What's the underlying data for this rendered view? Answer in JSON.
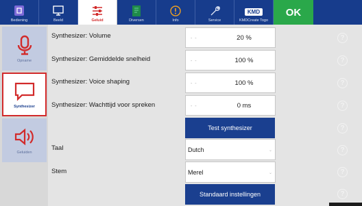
{
  "tabs": [
    {
      "label": "Bediening",
      "icon": "bediening-icon"
    },
    {
      "label": "Beeld",
      "icon": "monitor-icon"
    },
    {
      "label": "Geluid",
      "icon": "sliders-icon",
      "active": true
    },
    {
      "label": "Diversen",
      "icon": "diversen-icon"
    },
    {
      "label": "Info",
      "icon": "info-icon"
    },
    {
      "label": "Service",
      "icon": "wrench-icon"
    },
    {
      "label": "KMDCreate Togo",
      "icon": "kmd-logo",
      "logo_text": "KMD"
    }
  ],
  "ok_label": "OK",
  "sidebar": [
    {
      "label": "Opname",
      "icon": "microphone-icon"
    },
    {
      "label": "Synthesizer",
      "icon": "speech-bubble-icon",
      "active": true
    },
    {
      "label": "Geluiden",
      "icon": "speaker-icon"
    }
  ],
  "settings": {
    "volume": {
      "label": "Synthesizer: Volume",
      "value": "20 %"
    },
    "speed": {
      "label": "Synthesizer: Gemiddelde snelheid",
      "value": "100 %"
    },
    "voice_shaping": {
      "label": "Synthesizer: Voice shaping",
      "value": "100 %"
    },
    "wait_time": {
      "label": "Synthesizer: Wachttijd voor spreken",
      "value": "0 ms"
    },
    "slider_dashes": "- -"
  },
  "test_button": "Test synthesizer",
  "language": {
    "label": "Taal",
    "value": "Dutch"
  },
  "voice": {
    "label": "Stem",
    "value": "Merel"
  },
  "defaults_button": "Standaard instellingen",
  "help_glyph": "?",
  "caret_glyph": "⌄",
  "colors": {
    "topbar": "#173c8c",
    "accent_red": "#d22a2a",
    "ok_green": "#2aa84a",
    "button_blue": "#1a3f8f",
    "sidebar_item": "#c2cbe1",
    "background": "#e4e4e4"
  }
}
